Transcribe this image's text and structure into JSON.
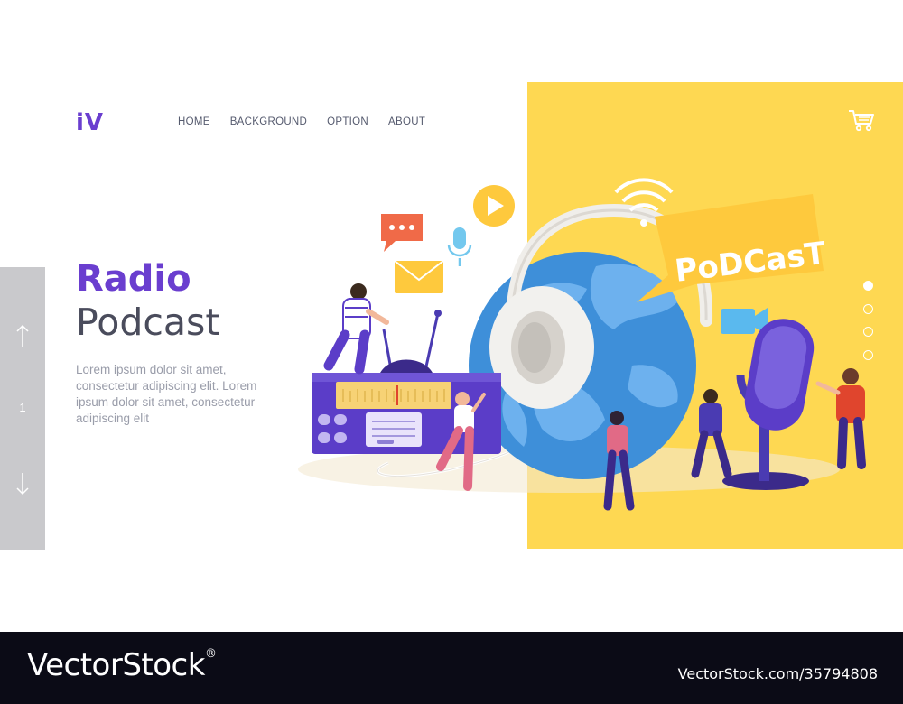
{
  "brand": {
    "logo": "iV",
    "logo_color": "#6a3ecf"
  },
  "nav": {
    "items": [
      "HOME",
      "BACKGROUND",
      "OPTION",
      "ABOUT"
    ]
  },
  "header": {
    "cart_icon": "shopping-cart-icon"
  },
  "hero": {
    "title": "Radio",
    "subtitle": "Podcast",
    "body": "Lorem ipsum dolor sit amet, consectetur adipiscing elit. Lorem ipsum dolor sit amet, consectetur adipiscing elit"
  },
  "slider": {
    "current": "1",
    "up_icon": "arrow-up-icon",
    "down_icon": "arrow-down-icon"
  },
  "pagination": {
    "count": 4,
    "active": 1
  },
  "illustration": {
    "bubble_text": "PoDCasT"
  },
  "colors": {
    "accent": "#6a3ecf",
    "panel": "#fed852",
    "slider": "#c9c9cc",
    "footer": "#0b0b16"
  },
  "watermark": {
    "brand": "VectorStock",
    "mark": "®",
    "url": "VectorStock.com/35794808"
  }
}
